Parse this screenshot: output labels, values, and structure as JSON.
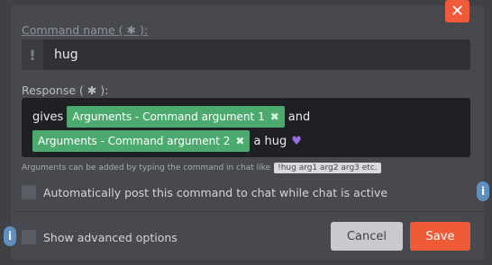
{
  "dialog": {
    "close_icon": "close-icon"
  },
  "command_name": {
    "label": "Command name ( ✱ ):",
    "prefix_icon": "!",
    "value": "hug"
  },
  "response": {
    "label": "Response ( ✱ ):",
    "line1_prefix": "gives",
    "chip1": "Arguments - Command argument 1",
    "line1_suffix": "and",
    "chip2": "Arguments - Command argument 2",
    "line2_suffix": "a hug",
    "heart_icon": "purple-heart-icon",
    "chip_remove_icon": "✖"
  },
  "hint": {
    "text": "Arguments can be added by typing the command in chat like",
    "example": "!hug arg1 arg2 arg3 etc."
  },
  "options": {
    "auto_post_label": "Automatically post this command to chat while chat is active",
    "advanced_label": "Show advanced options"
  },
  "buttons": {
    "cancel": "Cancel",
    "save": "Save"
  },
  "colors": {
    "accent": "#ef5b36",
    "chip": "#4caa6e",
    "info": "#5e8fbf"
  }
}
